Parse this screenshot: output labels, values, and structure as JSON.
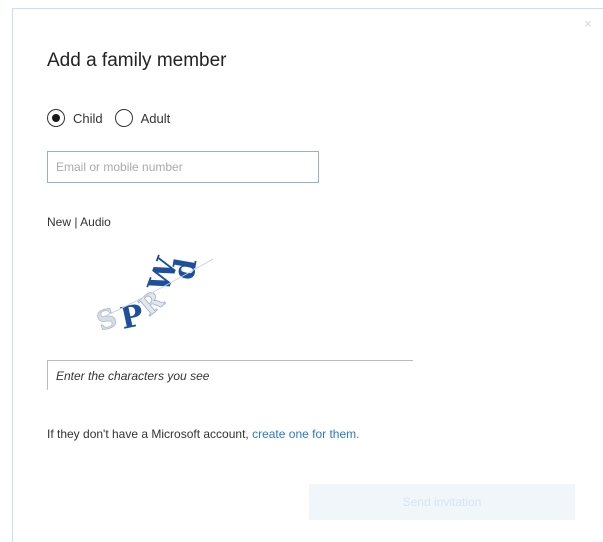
{
  "dialog": {
    "title": "Add a family member",
    "close_glyph": "×"
  },
  "member_type": {
    "options": [
      {
        "label": "Child",
        "selected": true
      },
      {
        "label": "Adult",
        "selected": false
      }
    ]
  },
  "email": {
    "value": "",
    "placeholder": "Email or mobile number"
  },
  "captcha": {
    "new_label": "New",
    "separator": " | ",
    "audio_label": "Audio",
    "image_text": "SPRWd",
    "input_value": "",
    "input_placeholder": "Enter the characters you see"
  },
  "account_note": {
    "text": "If they don't have a Microsoft account, ",
    "link_text": "create one for them."
  },
  "actions": {
    "send_label": "Send invitation"
  },
  "colors": {
    "accent": "#2a7ac9",
    "input_border": "#8fb3d6",
    "captcha_blue": "#1d4f9a",
    "button_bg": "#f1f6fb"
  }
}
